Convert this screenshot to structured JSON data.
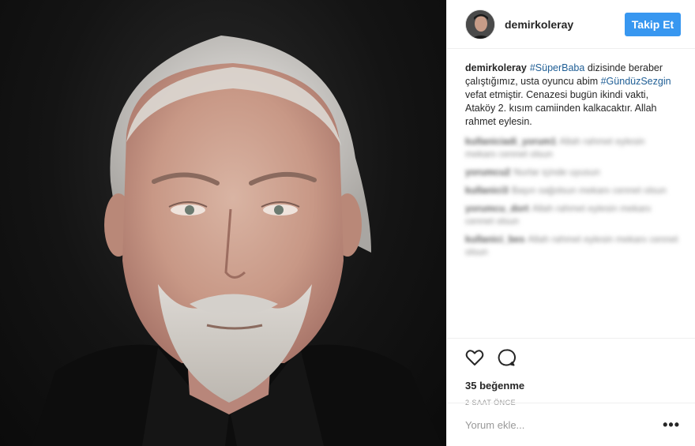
{
  "header": {
    "username": "demirkoleray",
    "follow_label": "Takip Et"
  },
  "caption": {
    "username": "demirkoleray",
    "tag1": "#SüperBaba",
    "text1": " dizisinde beraber çalıştığımız, usta oyuncu abim ",
    "tag2": "#GündüzSezgin",
    "text2": " vefat etmiştir. Cenazesi bugün ikindi vakti, Ataköy 2. kısım camiinden kalkacaktır. Allah rahmet eylesin."
  },
  "blurred_comments": [
    {
      "user": "kullaniciadi_yorum1",
      "text": "Allah rahmet eylesin mekanı cennet olsun"
    },
    {
      "user": "yorumcu2",
      "text": "Nurlar içinde uyusun"
    },
    {
      "user": "kullanici3",
      "text": "Başın sağolsun mekanı cennet olsun"
    },
    {
      "user": "yorumcu_dort",
      "text": "Allah rahmet eylesin mekanı cennet olsun"
    },
    {
      "user": "kullanici_bes",
      "text": "Allah rahmet eylesin mekanı cennet olsun"
    }
  ],
  "actions": {
    "like_icon": "heart-icon",
    "comment_icon": "comment-icon",
    "likes": "35 beğenme",
    "time": "2 SAAT ÖNCE"
  },
  "add_comment": {
    "placeholder": "Yorum ekle...",
    "more": "•••"
  },
  "colors": {
    "follow_button": "#3897f0",
    "hashtag": "#1f5e95",
    "border": "#efefef"
  }
}
